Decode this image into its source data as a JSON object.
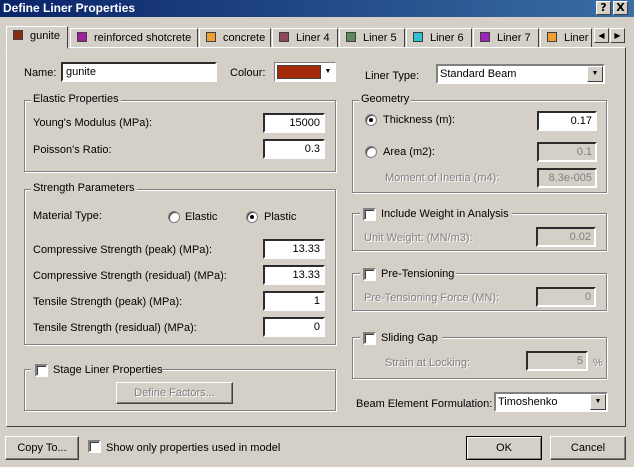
{
  "window": {
    "title": "Define Liner Properties",
    "help_label": "?",
    "close_label": "X"
  },
  "tabs": [
    {
      "label": "gunite",
      "color": "#8b2a10"
    },
    {
      "label": "reinforced shotcrete",
      "color": "#a020a0"
    },
    {
      "label": "concrete",
      "color": "#f0a030"
    },
    {
      "label": "Liner 4",
      "color": "#8b4a5a"
    },
    {
      "label": "Liner 5",
      "color": "#5a8a5a"
    },
    {
      "label": "Liner 6",
      "color": "#30c0d0"
    },
    {
      "label": "Liner 7",
      "color": "#a020c0"
    },
    {
      "label": "Liner",
      "color": "#f0a030"
    }
  ],
  "tab_scroll": {
    "left": "◀",
    "right": "▶"
  },
  "name": {
    "label": "Name:",
    "value": "gunite"
  },
  "colour": {
    "label": "Colour:",
    "value": "#a52a0a",
    "dropdown": "▼"
  },
  "liner_type": {
    "label": "Liner Type:",
    "value": "Standard Beam"
  },
  "elastic": {
    "title": "Elastic Properties",
    "youngs_label": "Young's Modulus (MPa):",
    "youngs_value": "15000",
    "poisson_label": "Poisson's Ratio:",
    "poisson_value": "0.3"
  },
  "strength": {
    "title": "Strength Parameters",
    "material_label": "Material Type:",
    "elastic_option": "Elastic",
    "plastic_option": "Plastic",
    "comp_peak_label": "Compressive Strength (peak) (MPa):",
    "comp_peak_value": "13.33",
    "comp_res_label": "Compressive Strength (residual) (MPa):",
    "comp_res_value": "13.33",
    "tens_peak_label": "Tensile Strength (peak) (MPa):",
    "tens_peak_value": "1",
    "tens_res_label": "Tensile Strength (residual) (MPa):",
    "tens_res_value": "0"
  },
  "stage": {
    "label": "Stage Liner Properties",
    "button": "Define Factors..."
  },
  "geometry": {
    "title": "Geometry",
    "thickness_label": "Thickness (m):",
    "thickness_value": "0.17",
    "area_label": "Area (m2):",
    "area_value": "0.1",
    "inertia_label": "Moment of Inertia (m4):",
    "inertia_value": "8.3e-005"
  },
  "weight": {
    "label": "Include Weight in Analysis",
    "unit_label": "Unit Weight: (MN/m3):",
    "unit_value": "0.02"
  },
  "pretension": {
    "label": "Pre-Tensioning",
    "force_label": "Pre-Tensioning Force (MN):",
    "force_value": "0"
  },
  "sliding": {
    "label": "Sliding Gap",
    "strain_label": "Strain at Locking:",
    "strain_value": "5",
    "unit": "%"
  },
  "beam": {
    "label": "Beam Element Formulation:",
    "value": "Timoshenko"
  },
  "footer": {
    "copy_button": "Copy To...",
    "show_only_label": "Show only properties used in model",
    "ok_button": "OK",
    "cancel_button": "Cancel"
  }
}
